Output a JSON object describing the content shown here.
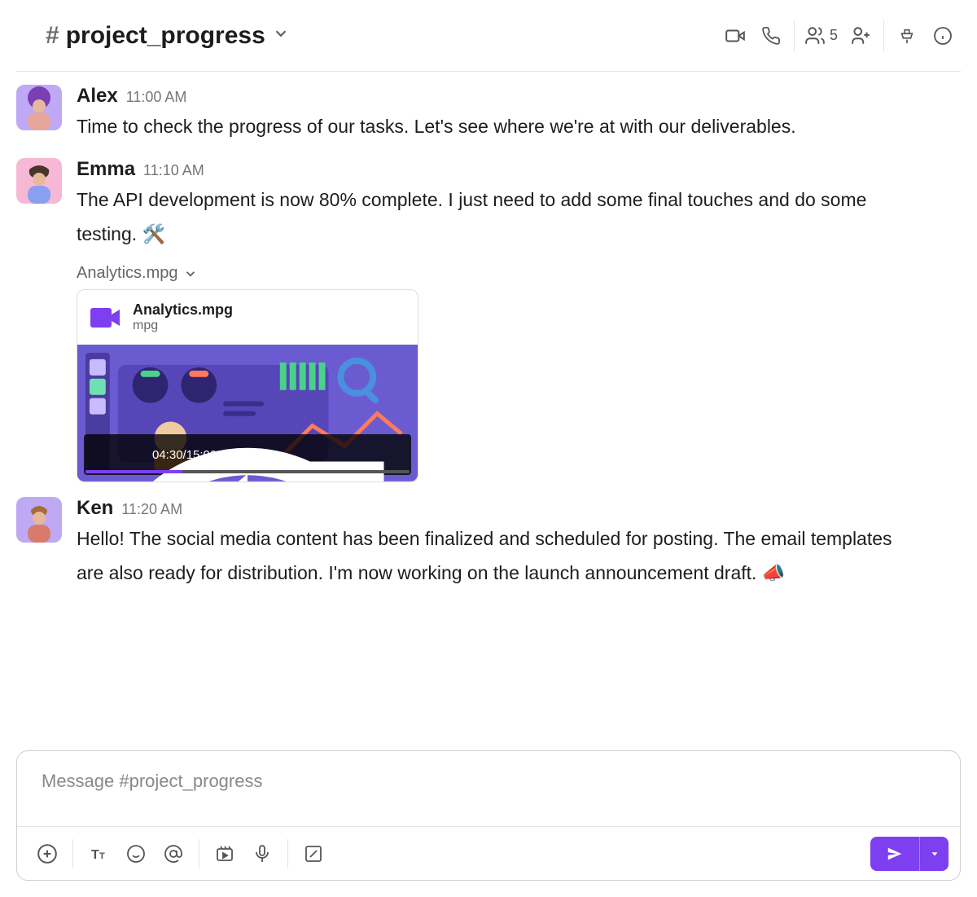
{
  "header": {
    "channel_prefix": "#",
    "channel_name": "project_progress",
    "members_count": "5"
  },
  "composer": {
    "placeholder": "Message #project_progress"
  },
  "messages": [
    {
      "author": "Alex",
      "time": "11:00 AM",
      "text": "Time to check the progress of our tasks. Let's see where we're at with our deliverables."
    },
    {
      "author": "Emma",
      "time": "11:10 AM",
      "text": "The API development is now 80% complete. I just need to add some final touches and do some testing. 🛠️",
      "attachment": {
        "label": "Analytics.mpg",
        "filename": "Analytics.mpg",
        "filetype": "mpg",
        "timecode": "04:30/15:00"
      }
    },
    {
      "author": "Ken",
      "time": "11:20 AM",
      "text": "Hello! The social media content has been finalized and scheduled for posting. The email templates are also ready for distribution. I'm now working on the launch announcement draft. 📣"
    }
  ]
}
